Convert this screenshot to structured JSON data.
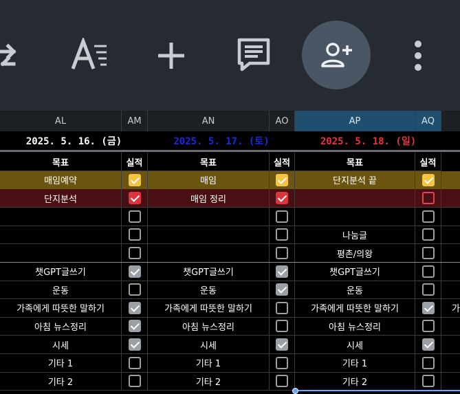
{
  "columns": [
    {
      "key": "AL",
      "label": "AL",
      "selected": false
    },
    {
      "key": "AM",
      "label": "AM",
      "selected": false
    },
    {
      "key": "AN",
      "label": "AN",
      "selected": false
    },
    {
      "key": "AO",
      "label": "AO",
      "selected": false
    },
    {
      "key": "AP",
      "label": "AP",
      "selected": true
    },
    {
      "key": "AQ",
      "label": "AQ",
      "selected": true
    }
  ],
  "dates": [
    {
      "text": "2025. 5. 16. (금)",
      "color": "#ffffff"
    },
    {
      "text": "2025. 5. 17. (토)",
      "color": "#1a2bd6"
    },
    {
      "text": "2025. 5. 18. (일)",
      "color": "#e0383e"
    }
  ],
  "headers": {
    "goal": "목표",
    "done": "실적"
  },
  "colors": {
    "row_yellow": "#6b5510",
    "row_red": "#4a0f12",
    "toolbar": "#262b33",
    "accent_selected": "#1f4e6e"
  },
  "rows": [
    {
      "bg": "yellow",
      "cells": [
        {
          "g": "매임예약",
          "c": "yellow"
        },
        {
          "g": "매임",
          "c": "yellow"
        },
        {
          "g": "단지분석 끝",
          "c": "yellow"
        }
      ]
    },
    {
      "bg": "red",
      "cells": [
        {
          "g": "단지분석",
          "c": "red"
        },
        {
          "g": "매임 정리",
          "c": "red"
        },
        {
          "g": "",
          "c": "redo"
        }
      ]
    },
    {
      "bg": "",
      "cells": [
        {
          "g": "",
          "c": "empty"
        },
        {
          "g": "",
          "c": "empty"
        },
        {
          "g": "",
          "c": "empty"
        }
      ]
    },
    {
      "bg": "",
      "cells": [
        {
          "g": "",
          "c": "empty"
        },
        {
          "g": "",
          "c": "empty"
        },
        {
          "g": "나눔글",
          "c": "empty"
        }
      ]
    },
    {
      "bg": "",
      "cells": [
        {
          "g": "",
          "c": "empty"
        },
        {
          "g": "",
          "c": "empty"
        },
        {
          "g": "평촌/의왕",
          "c": "empty"
        }
      ]
    },
    {
      "bg": "",
      "cells": [
        {
          "g": "챗GPT글쓰기",
          "c": "checked"
        },
        {
          "g": "챗GPT글쓰기",
          "c": "checked"
        },
        {
          "g": "챗GPT글쓰기",
          "c": "empty"
        }
      ]
    },
    {
      "bg": "",
      "cells": [
        {
          "g": "운동",
          "c": "empty"
        },
        {
          "g": "운동",
          "c": "checked"
        },
        {
          "g": "운동",
          "c": "empty"
        }
      ]
    },
    {
      "bg": "",
      "cells": [
        {
          "g": "가족에게 따뜻한 말하기",
          "c": "checked"
        },
        {
          "g": "가족에게 따뜻한 말하기",
          "c": "empty"
        },
        {
          "g": "가족에게 따뜻한 말하기",
          "c": "checked"
        }
      ]
    },
    {
      "bg": "",
      "cells": [
        {
          "g": "아침 뉴스정리",
          "c": "checked"
        },
        {
          "g": "아침 뉴스정리",
          "c": "empty"
        },
        {
          "g": "아침 뉴스정리",
          "c": "empty"
        }
      ]
    },
    {
      "bg": "",
      "cells": [
        {
          "g": "시세",
          "c": "checked"
        },
        {
          "g": "시세",
          "c": "checked"
        },
        {
          "g": "시세",
          "c": "checked"
        }
      ]
    },
    {
      "bg": "",
      "cells": [
        {
          "g": "기타 1",
          "c": "empty"
        },
        {
          "g": "기타 1",
          "c": "empty"
        },
        {
          "g": "기타 1",
          "c": "empty"
        }
      ]
    },
    {
      "bg": "",
      "cells": [
        {
          "g": "기타 2",
          "c": "empty"
        },
        {
          "g": "기타 2",
          "c": "empty"
        },
        {
          "g": "기타 2",
          "c": "empty"
        }
      ]
    }
  ],
  "edge_text": "가",
  "icons": [
    "redo-icon",
    "text-format-icon",
    "insert-icon",
    "comment-icon",
    "add-person-icon",
    "more-vert-icon"
  ]
}
